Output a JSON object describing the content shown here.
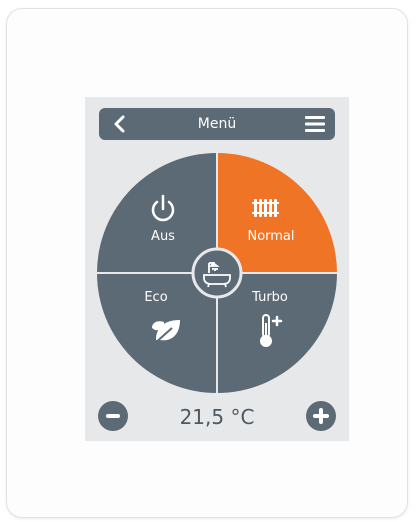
{
  "header": {
    "title": "Menü"
  },
  "modes": {
    "off": {
      "label": "Aus",
      "icon": "power-icon"
    },
    "normal": {
      "label": "Normal",
      "icon": "radiator-icon",
      "selected": true
    },
    "eco": {
      "label": "Eco",
      "icon": "leaf-icon"
    },
    "turbo": {
      "label": "Turbo",
      "icon": "thermometer-plus-icon"
    },
    "center": {
      "icon": "bathtub-shower-icon"
    }
  },
  "temperature": {
    "value": "21,5 °C"
  },
  "colors": {
    "accent": "#f07425",
    "slate": "#5c6a76",
    "screen_bg": "#e7e8ea"
  }
}
